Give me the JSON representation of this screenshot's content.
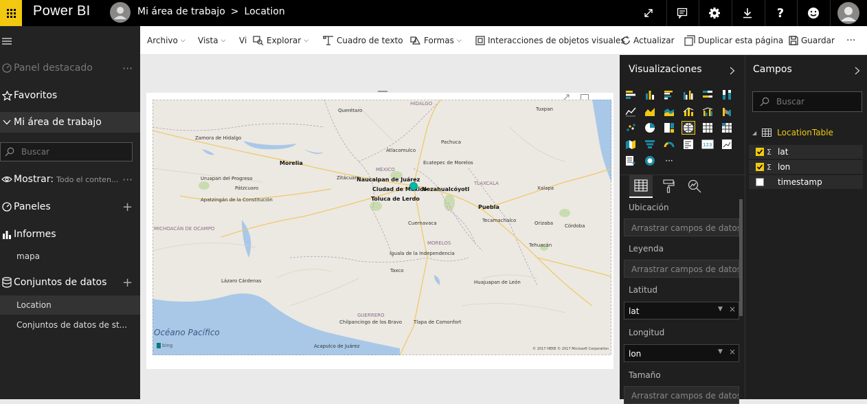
{
  "header": {
    "app_name": "Power BI",
    "breadcrumb_workspace": "Mi área de trabajo",
    "breadcrumb_separator": ">",
    "breadcrumb_report": "Location"
  },
  "nav": {
    "featured": "Panel destacado",
    "favorites": "Favoritos",
    "my_workspace": "Mi área de trabajo",
    "search_placeholder": "Buscar",
    "show_label": "Mostrar:",
    "show_value": "Todo el conten...",
    "dashboards": "Paneles",
    "reports": "Informes",
    "report_item": "mapa",
    "datasets": "Conjuntos de datos",
    "dataset_item_1": "Location",
    "dataset_item_2": "Conjuntos de datos de st...",
    "more": "···",
    "plus": "+"
  },
  "toolbar": {
    "archivo": "Archivo",
    "vista": "Vista",
    "vi_truncated": "Vi",
    "explorar": "Explorar",
    "cuadro": "Cuadro de texto",
    "formas": "Formas",
    "interacciones": "Interacciones de objetos visuales",
    "actualizar": "Actualizar",
    "duplicar": "Duplicar esta página",
    "guardar": "Guardar",
    "more": "···"
  },
  "visualizations": {
    "title": "Visualizaciones",
    "wells": [
      {
        "name": "Ubicación",
        "value": "Arrastrar campos de datos ..."
      },
      {
        "name": "Leyenda",
        "value": "Arrastrar campos de datos ..."
      },
      {
        "name": "Latitud",
        "value": "lat"
      },
      {
        "name": "Longitud",
        "value": "lon"
      },
      {
        "name": "Tamaño",
        "value": "Arrastrar campos de datos ..."
      }
    ],
    "more_icon": "···"
  },
  "fields": {
    "title": "Campos",
    "search_placeholder": "Buscar",
    "table_name": "LocationTable",
    "items": [
      {
        "name": "lat",
        "checked": true,
        "sigma": "Σ"
      },
      {
        "name": "lon",
        "checked": true,
        "sigma": "Σ"
      },
      {
        "name": "timestamp",
        "checked": false,
        "sigma": ""
      }
    ]
  },
  "map": {
    "labels": {
      "queretaro": "Querétaro",
      "morelia": "Morelia",
      "naucalpan": "Naucalpan de Juárez",
      "cdmx": "Ciudad de México",
      "neza": "Nezahualcóyotl",
      "toluca": "Toluca de Lerdo",
      "puebla": "Puebla",
      "ecatepec": "Ecatepec de Morelos",
      "tlaxcala": "TLAXCALA",
      "cuernavaca": "Cuernavaca",
      "morelos": "MORELOS",
      "guerrero": "GUERRERO",
      "chilpancingo": "Chilpancingo de los Bravo",
      "acapulco": "Acapulco de Juárez",
      "ocean": "Océano Pacífico",
      "michoacan": "MICHOACÁN DE OCAMPO",
      "mexico": "MÉXICO",
      "hidalgo": "HIDALGO",
      "orizaba": "Orizaba",
      "tehuacan": "Tehuacán",
      "uruapan": "Uruapan del Progreso",
      "apatzingan": "Apatzingán de la Constitución",
      "lazaro": "Lázaro Cárdenas",
      "iguala": "Iguala de la Independencia",
      "pachuca": "Pachuca",
      "zitacuaro": "Zitácuaro",
      "taxco": "Taxco",
      "tlapa": "Tlapa de Comonfort",
      "huajuapan": "Huajuapan de León",
      "zamora": "Zamora de Hidalgo",
      "patzcuaro": "Pátzcuaro",
      "atlacomulco": "Atlacomulco",
      "tuxpan": "Tuxpan",
      "xalapa": "Xalapa",
      "cordoba": "Córdoba",
      "tecamachalco": "Tecamachalco",
      "bing": "bing",
      "copyright": "© 2017 HERE   © 2017 Microsoft Corporation"
    }
  },
  "colors": {
    "accent": "#f2c811",
    "dot": "#01b8aa"
  }
}
